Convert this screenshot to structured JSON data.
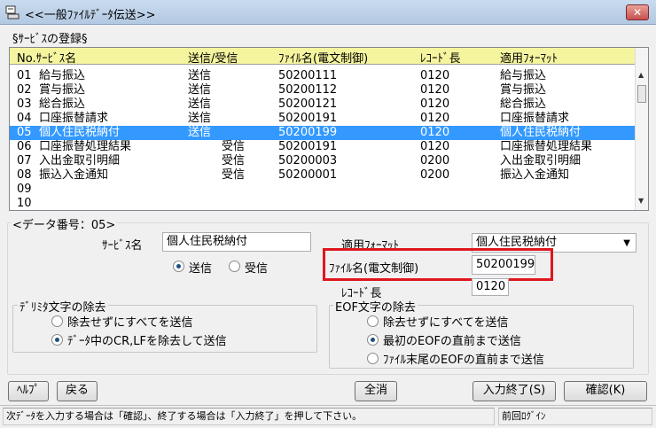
{
  "window": {
    "title": "<<一般ﾌｧｲﾙﾃﾞｰﾀ伝送>>",
    "close_glyph": "✕"
  },
  "section_title": "§ｻｰﾋﾞｽの登録§",
  "list": {
    "headers": [
      "No.ｻｰﾋﾞｽ名",
      "送信/受信",
      "ﾌｧｲﾙ名(電文制御)",
      "ﾚｺｰﾄﾞ長",
      "適用ﾌｫｰﾏｯﾄ"
    ],
    "rows": [
      {
        "no": "01",
        "name": "給与振込",
        "dir": "送信",
        "file": "50200111",
        "len": "0120",
        "fmt": "給与振込"
      },
      {
        "no": "02",
        "name": "賞与振込",
        "dir": "送信",
        "file": "50200112",
        "len": "0120",
        "fmt": "賞与振込"
      },
      {
        "no": "03",
        "name": "総合振込",
        "dir": "送信",
        "file": "50200121",
        "len": "0120",
        "fmt": "総合振込"
      },
      {
        "no": "04",
        "name": "口座振替請求",
        "dir": "送信",
        "file": "50200191",
        "len": "0120",
        "fmt": "口座振替請求"
      },
      {
        "no": "05",
        "name": "個人住民税納付",
        "dir": "送信",
        "file": "50200199",
        "len": "0120",
        "fmt": "個人住民税納付"
      },
      {
        "no": "06",
        "name": "口座振替処理結果",
        "dir": "受信",
        "file": "50200191",
        "len": "0120",
        "fmt": "口座振替処理結果"
      },
      {
        "no": "07",
        "name": "入出金取引明細",
        "dir": "受信",
        "file": "50200003",
        "len": "0200",
        "fmt": "入出金取引明細"
      },
      {
        "no": "08",
        "name": "振込入金通知",
        "dir": "受信",
        "file": "50200001",
        "len": "0200",
        "fmt": "振込入金通知"
      },
      {
        "no": "09",
        "name": "",
        "dir": "",
        "file": "",
        "len": "",
        "fmt": ""
      },
      {
        "no": "10",
        "name": "",
        "dir": "",
        "file": "",
        "len": "",
        "fmt": ""
      }
    ],
    "selected_index": 4
  },
  "detail": {
    "title": "<データ番号：05>",
    "service_label": "ｻｰﾋﾞｽ名",
    "service_value": "個人住民税納付",
    "send_label": "送信",
    "receive_label": "受信",
    "format_label": "適用ﾌｫｰﾏｯﾄ",
    "format_value": "個人住民税納付",
    "filename_label": "ﾌｧｲﾙ名(電文制御)",
    "filename_value": "50200199",
    "record_label": "ﾚｺｰﾄﾞ長",
    "record_value": "0120"
  },
  "delimiter_group": {
    "title": "ﾃﾞﾘﾐﾀ文字の除去",
    "options": [
      "除去せずにすべてを送信",
      "ﾃﾞｰﾀ中のCR,LFを除去して送信"
    ],
    "selected": 1
  },
  "eof_group": {
    "title": "EOF文字の除去",
    "options": [
      "除去せずにすべてを送信",
      "最初のEOFの直前まで送信",
      "ﾌｧｲﾙ末尾のEOFの直前まで送信"
    ],
    "selected": 1
  },
  "buttons": {
    "help": "ﾍﾙﾌﾟ",
    "back": "戻る",
    "clear": "全消",
    "finish": "入力終了(S)",
    "confirm": "確認(K)"
  },
  "status": {
    "message": "次ﾃﾞｰﾀを入力する場合は「確認」、終了する場合は「入力終了」を押して下さい。",
    "last_login": "前回ﾛｸﾞｲﾝ"
  }
}
